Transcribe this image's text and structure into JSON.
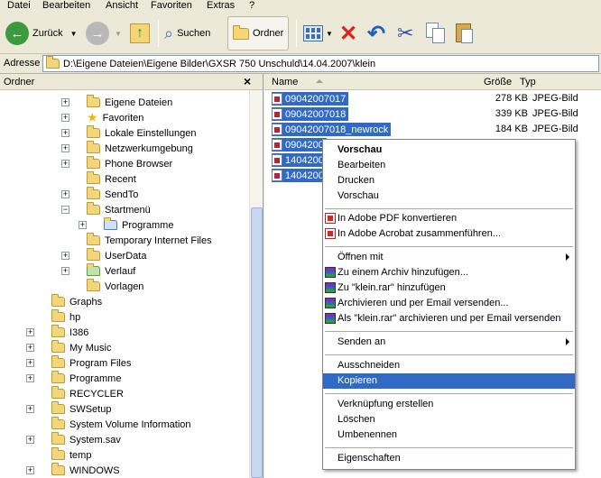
{
  "menubar": {
    "items": [
      "Datei",
      "Bearbeiten",
      "Ansicht",
      "Favoriten",
      "Extras",
      "?"
    ]
  },
  "toolbar": {
    "back_label": "Zurück",
    "search_label": "Suchen",
    "folders_label": "Ordner"
  },
  "address": {
    "label": "Adresse",
    "value": "D:\\Eigene Dateien\\Eigene Bilder\\GXSR 750 Unschuld\\14.04.2007\\klein"
  },
  "left_pane": {
    "title": "Ordner",
    "close": "×",
    "items": [
      {
        "label": "Eigene Dateien",
        "expander": "+"
      },
      {
        "label": "Favoriten",
        "expander": "+"
      },
      {
        "label": "Lokale Einstellungen",
        "expander": "+"
      },
      {
        "label": "Netzwerkumgebung",
        "expander": "+"
      },
      {
        "label": "Phone Browser",
        "expander": "+"
      },
      {
        "label": "Recent",
        "expander": ""
      },
      {
        "label": "SendTo",
        "expander": "+"
      },
      {
        "label": "Startmenü",
        "expander": "−"
      },
      {
        "label": "Programme",
        "expander": "+"
      },
      {
        "label": "Temporary Internet Files",
        "expander": ""
      },
      {
        "label": "UserData",
        "expander": "+"
      },
      {
        "label": "Verlauf",
        "expander": "+"
      },
      {
        "label": "Vorlagen",
        "expander": ""
      },
      {
        "label": "Graphs",
        "expander": ""
      },
      {
        "label": "hp",
        "expander": ""
      },
      {
        "label": "I386",
        "expander": "+"
      },
      {
        "label": "My Music",
        "expander": "+"
      },
      {
        "label": "Program Files",
        "expander": "+"
      },
      {
        "label": "Programme",
        "expander": "+"
      },
      {
        "label": "RECYCLER",
        "expander": ""
      },
      {
        "label": "SWSetup",
        "expander": "+"
      },
      {
        "label": "System Volume Information",
        "expander": ""
      },
      {
        "label": "System.sav",
        "expander": "+"
      },
      {
        "label": "temp",
        "expander": ""
      },
      {
        "label": "WINDOWS",
        "expander": "+"
      }
    ]
  },
  "right_pane": {
    "columns": {
      "name": "Name",
      "size": "Größe",
      "type": "Typ"
    },
    "files": [
      {
        "name": "09042007017",
        "size": "278 KB",
        "type": "JPEG-Bild"
      },
      {
        "name": "09042007018",
        "size": "339 KB",
        "type": "JPEG-Bild"
      },
      {
        "name": "09042007018_newrock",
        "size": "184 KB",
        "type": "JPEG-Bild"
      },
      {
        "name": "0904200",
        "size": "",
        "type": ""
      },
      {
        "name": "1404200",
        "size": "",
        "type": ""
      },
      {
        "name": "1404200",
        "size": "",
        "type": ""
      }
    ]
  },
  "context_menu": {
    "items": [
      "Vorschau",
      "Bearbeiten",
      "Drucken",
      "Vorschau",
      "In Adobe PDF konvertieren",
      "In Adobe Acrobat zusammenführen...",
      "Öffnen mit",
      "Zu einem Archiv hinzufügen...",
      "Zu \"klein.rar\" hinzufügen",
      "Archivieren und per Email versenden...",
      "Als \"klein.rar\" archivieren und per Email versenden",
      "Senden an",
      "Ausschneiden",
      "Kopieren",
      "Verknüpfung erstellen",
      "Löschen",
      "Umbenennen",
      "Eigenschaften"
    ]
  },
  "colors": {
    "selection": "#316ac5",
    "window_bg": "#ece9d8",
    "folder": "#f4d67a"
  }
}
